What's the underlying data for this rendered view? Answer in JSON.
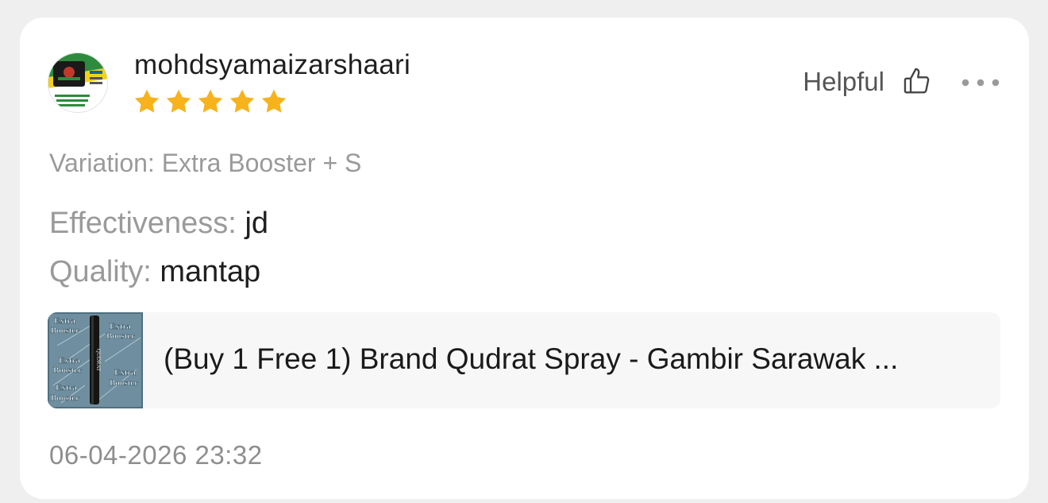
{
  "review": {
    "username": "mohdsyamaizarshaari",
    "rating": 5,
    "rating_max": 5,
    "helpful_label": "Helpful",
    "variation": "Variation: Extra Booster + S",
    "attributes": [
      {
        "key": "Effectiveness:",
        "value": "jd"
      },
      {
        "key": "Quality:",
        "value": "mantap"
      }
    ],
    "product": {
      "title": "(Buy 1 Free 1) Brand Qudrat Spray - Gambir Sarawak ...",
      "thumbnail_text": [
        "Extra",
        "Booster",
        "QUDRAT"
      ]
    },
    "timestamp": "06-04-2026 23:32"
  },
  "icons": {
    "helpful": "thumbs-up-icon",
    "more": "more-options-icon",
    "star": "star-icon"
  },
  "colors": {
    "star": "#f7b21c",
    "background": "#efefef",
    "card": "#ffffff"
  }
}
